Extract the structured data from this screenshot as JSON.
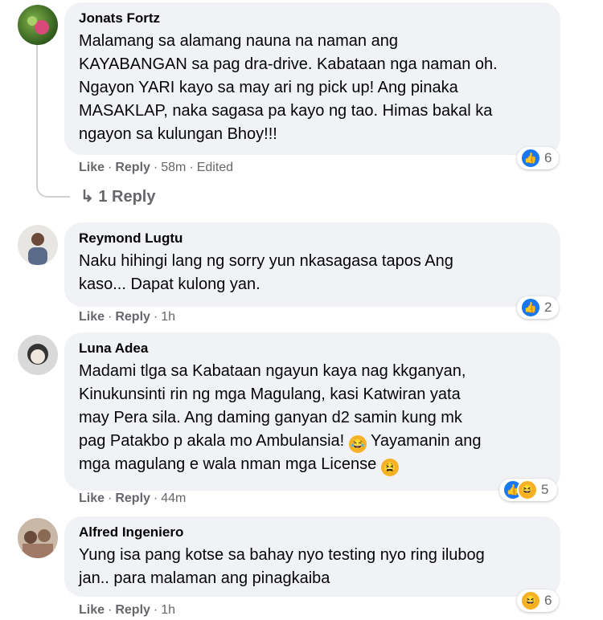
{
  "comments": [
    {
      "author": "Jonats Fortz",
      "text_lines": [
        "Malamang sa alamang nauna na naman ang",
        "KAYABANGAN sa pag dra-drive. Kabataan nga naman oh.",
        "Ngayon YARI kayo sa may ari ng pick up! Ang pinaka",
        "MASAKLAP, naka sagasa pa kayo ng tao. Himas bakal ka",
        "ngayon sa kulungan Bhoy!!!"
      ],
      "like": "Like",
      "reply": "Reply",
      "time": "58m",
      "edited": "Edited",
      "reaction_count": "6",
      "replies_label": "1 Reply"
    },
    {
      "author": "Reymond Lugtu",
      "text_lines": [
        "Naku hihingi lang ng sorry yun nkasagasa tapos Ang",
        "kaso... Dapat kulong yan."
      ],
      "like": "Like",
      "reply": "Reply",
      "time": "1h",
      "reaction_count": "2"
    },
    {
      "author": "Luna Adea",
      "text_lines": [
        "Madami tlga sa Kabataan ngayun kaya nag kkganyan,",
        "Kinukunsinti rin ng mga Magulang, kasi Katwiran yata",
        "may Pera sila. Ang daming ganyan d2 samin kung mk",
        "pag Patakbo p akala mo Ambulansia!",
        " Yayamanin ang",
        "mga magulang e wala nman mga License"
      ],
      "like": "Like",
      "reply": "Reply",
      "time": "44m",
      "reaction_count": "5"
    },
    {
      "author": "Alfred Ingeniero",
      "text_lines": [
        "Yung isa pang kotse sa bahay nyo testing nyo ring ilubog",
        "jan.. para malaman ang pinagkaiba"
      ],
      "like": "Like",
      "reply": "Reply",
      "time": "1h",
      "reaction_count": "6"
    }
  ],
  "icons": {
    "like_color": "#1877f2",
    "haha_color": "#f7b125"
  }
}
